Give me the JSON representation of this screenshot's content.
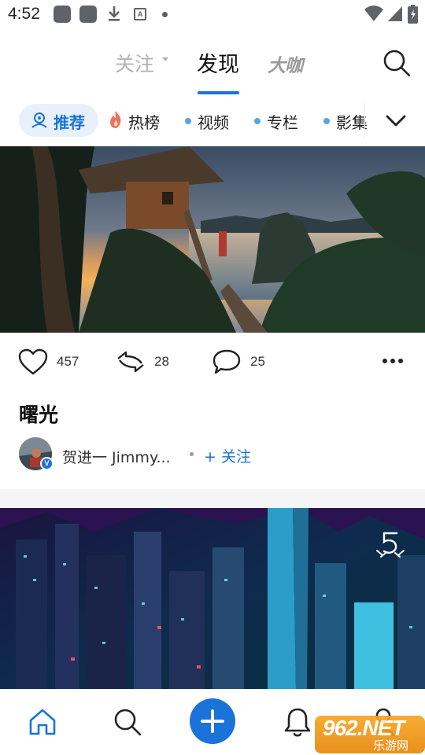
{
  "status_bar": {
    "time": "4:52",
    "icons": [
      "notification-app-icon",
      "notification-app-icon",
      "download-icon",
      "a-icon",
      "dot-icon",
      "wifi-icon",
      "signal-icon",
      "battery-icon"
    ]
  },
  "header": {
    "tabs": [
      {
        "label": "关注",
        "state": "inactive",
        "has_dropdown": true
      },
      {
        "label": "发现",
        "state": "active"
      },
      {
        "label": "大咖",
        "state": "inactive"
      }
    ],
    "search_icon": "search-icon",
    "accent_color": "#1a73d8"
  },
  "categories": {
    "items": [
      {
        "label": "推荐",
        "icon": "recommend-icon",
        "active": true
      },
      {
        "label": "热榜",
        "icon": "flame-icon"
      },
      {
        "label": "视频",
        "icon": "dot-icon"
      },
      {
        "label": "专栏",
        "icon": "dot-icon"
      },
      {
        "label": "影集",
        "icon": "dot-icon"
      }
    ],
    "expand_icon": "chevron-down-icon"
  },
  "feed": {
    "post1": {
      "image": "treehouse-sunset-coast-photo",
      "likes": "457",
      "shares": "28",
      "comments": "25",
      "title": "曙光",
      "author": "贺进一 Jimmy...",
      "verified_badge": "V",
      "follow_label": "+ 关注"
    },
    "post2": {
      "image": "night-city-skyscrapers-photo",
      "badge_icon": "five-award-icon"
    }
  },
  "bottom_nav": {
    "items": [
      "home-icon",
      "search-icon",
      "add-icon",
      "bell-icon",
      "profile-icon"
    ],
    "active": "home-icon"
  },
  "watermark": {
    "top": "962.NET",
    "bottom": "乐游网"
  }
}
